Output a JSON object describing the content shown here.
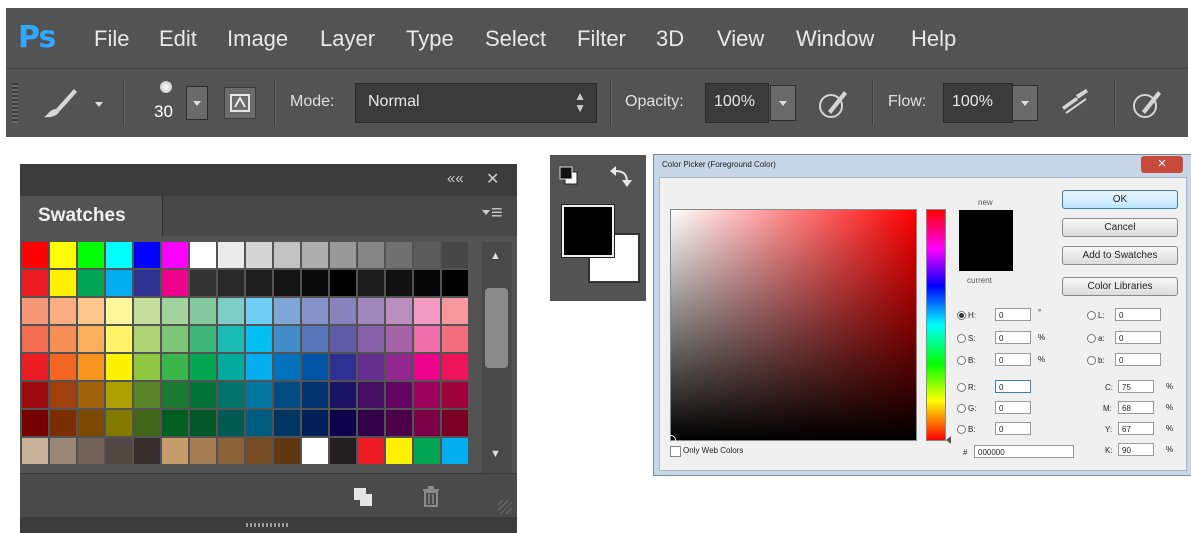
{
  "menubar": {
    "logo": "Ps",
    "items": [
      "File",
      "Edit",
      "Image",
      "Layer",
      "Type",
      "Select",
      "Filter",
      "3D",
      "View",
      "Window",
      "Help"
    ]
  },
  "options": {
    "brush_size": "30",
    "mode_label": "Mode:",
    "mode_value": "Normal",
    "opacity_label": "Opacity:",
    "opacity_value": "100%",
    "flow_label": "Flow:",
    "flow_value": "100%"
  },
  "swatches": {
    "tab_label": "Swatches",
    "collapse_glyph": "««",
    "close_glyph": "✕",
    "menu_glyph": "≡",
    "colors": [
      "#ff0000",
      "#ffff00",
      "#00ff00",
      "#00ffff",
      "#0000ff",
      "#ff00ff",
      "#ffffff",
      "#ebebeb",
      "#d6d6d6",
      "#c2c2c2",
      "#adadad",
      "#999999",
      "#858585",
      "#707070",
      "#5c5c5c",
      "#474747",
      "#ed1c24",
      "#fff200",
      "#00a651",
      "#00aeef",
      "#2e3192",
      "#ec008c",
      "#333333",
      "#292929",
      "#1f1f1f",
      "#141414",
      "#0a0a0a",
      "#000000",
      "#1a1a1a",
      "#111111",
      "#080808",
      "#000000",
      "#f7977a",
      "#f9ad81",
      "#fdc68a",
      "#fff79a",
      "#c4df9b",
      "#a3d39c",
      "#82ca9d",
      "#7bcdc8",
      "#6ecff6",
      "#7ea7d8",
      "#8493ca",
      "#8882be",
      "#a187be",
      "#bc8dbf",
      "#f49ac2",
      "#f6989d",
      "#f26c4f",
      "#f68e55",
      "#fbaf5c",
      "#fff467",
      "#acd372",
      "#7cc576",
      "#3bb878",
      "#1abbb4",
      "#00bff3",
      "#438cca",
      "#5574b9",
      "#605ca8",
      "#855fa8",
      "#a763a8",
      "#f06ea9",
      "#f26d7d",
      "#ed1c24",
      "#f26522",
      "#f7941d",
      "#fff200",
      "#8dc73f",
      "#39b54a",
      "#00a651",
      "#00a99d",
      "#00aeef",
      "#0072bc",
      "#0054a6",
      "#2e3192",
      "#662d91",
      "#92278f",
      "#ec008c",
      "#ed145b",
      "#9e0b0f",
      "#a0410d",
      "#a36209",
      "#aba000",
      "#598527",
      "#1a7b30",
      "#007236",
      "#00746b",
      "#0076a3",
      "#004b80",
      "#003471",
      "#1b1464",
      "#440e62",
      "#630460",
      "#9e005d",
      "#9e0039",
      "#790000",
      "#7b2e00",
      "#7d4900",
      "#827b00",
      "#406618",
      "#005e20",
      "#005826",
      "#005952",
      "#005b7f",
      "#003663",
      "#002157",
      "#0d004c",
      "#32004b",
      "#4b0049",
      "#7b0046",
      "#7a0026",
      "#c7b299",
      "#998675",
      "#736357",
      "#534741",
      "#37302d",
      "#c69c6d",
      "#a67c52",
      "#8c6239",
      "#754c24",
      "#603913",
      "#ffffff",
      "#231f20",
      "#ed1c24",
      "#fff200",
      "#00a651",
      "#00aeef"
    ],
    "scroll_up": "▲",
    "scroll_down": "▼"
  },
  "tools": {
    "foreground_color": "#000000",
    "background_color": "#ffffff"
  },
  "picker": {
    "title": "Color Picker (Foreground Color)",
    "close_glyph": "✕",
    "new_label": "new",
    "current_label": "current",
    "ok": "OK",
    "cancel": "Cancel",
    "add_to_swatches": "Add to Swatches",
    "color_libraries": "Color Libraries",
    "hsb": [
      {
        "label": "H:",
        "value": "0",
        "unit": "°"
      },
      {
        "label": "S:",
        "value": "0",
        "unit": "%"
      },
      {
        "label": "B:",
        "value": "0",
        "unit": "%"
      }
    ],
    "rgb": [
      {
        "label": "R:",
        "value": "0"
      },
      {
        "label": "G:",
        "value": "0"
      },
      {
        "label": "B:",
        "value": "0"
      }
    ],
    "lab": [
      {
        "label": "L:",
        "value": "0"
      },
      {
        "label": "a:",
        "value": "0"
      },
      {
        "label": "b:",
        "value": "0"
      }
    ],
    "cmyk": [
      {
        "label": "C:",
        "value": "75",
        "unit": "%"
      },
      {
        "label": "M:",
        "value": "68",
        "unit": "%"
      },
      {
        "label": "Y:",
        "value": "67",
        "unit": "%"
      },
      {
        "label": "K:",
        "value": "90",
        "unit": "%"
      }
    ],
    "hex_label": "#",
    "hex_value": "000000",
    "only_web_colors": "Only Web Colors"
  }
}
